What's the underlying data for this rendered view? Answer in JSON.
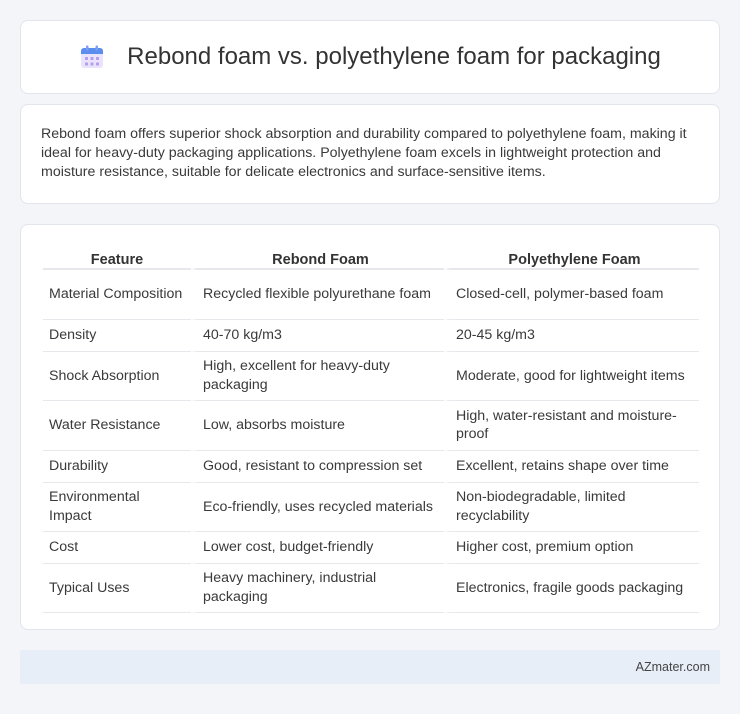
{
  "header": {
    "title": "Rebond foam vs. polyethylene foam for packaging",
    "icon": "calendar-icon"
  },
  "description": "Rebond foam offers superior shock absorption and durability compared to polyethylene foam, making it ideal for heavy-duty packaging applications. Polyethylene foam excels in lightweight protection and moisture resistance, suitable for delicate electronics and surface-sensitive items.",
  "table": {
    "headers": [
      "Feature",
      "Rebond Foam",
      "Polyethylene Foam"
    ],
    "rows": [
      [
        "Material Composition",
        "Recycled flexible polyurethane foam",
        "Closed-cell, polymer-based foam"
      ],
      [
        "Density",
        "40-70 kg/m3",
        "20-45 kg/m3"
      ],
      [
        "Shock Absorption",
        "High, excellent for heavy-duty packaging",
        "Moderate, good for lightweight items"
      ],
      [
        "Water Resistance",
        "Low, absorbs moisture",
        "High, water-resistant and moisture-proof"
      ],
      [
        "Durability",
        "Good, resistant to compression set",
        "Excellent, retains shape over time"
      ],
      [
        "Environmental Impact",
        "Eco-friendly, uses recycled materials",
        "Non-biodegradable, limited recyclability"
      ],
      [
        "Cost",
        "Lower cost, budget-friendly",
        "Higher cost, premium option"
      ],
      [
        "Typical Uses",
        "Heavy machinery, industrial packaging",
        "Electronics, fragile goods packaging"
      ]
    ]
  },
  "footer": {
    "site": "AZmater.com"
  },
  "colors": {
    "icon_blue": "#5b8def",
    "icon_purple": "#b59cf0",
    "footer_bg": "#e8eef8"
  }
}
